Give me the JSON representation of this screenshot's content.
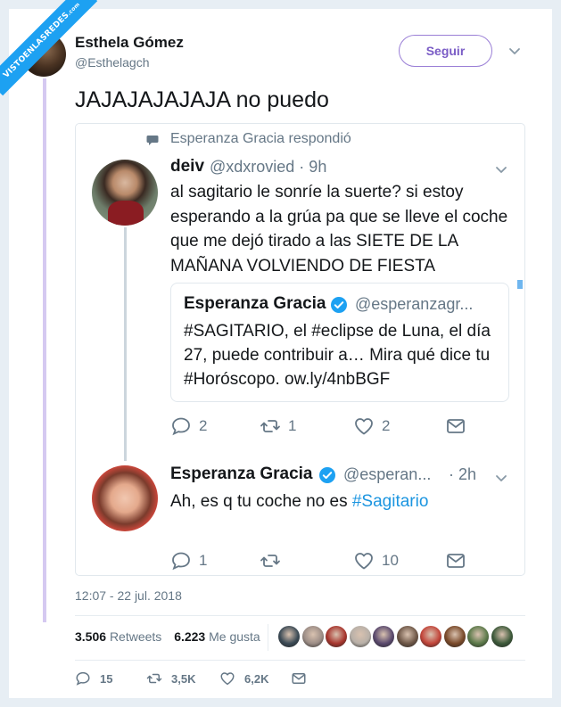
{
  "watermark": {
    "text": "VISTOENLASREDES",
    "suffix": ".com"
  },
  "author": {
    "name": "Esthela Gómez",
    "handle": "@Esthelagch"
  },
  "follow_label": "Seguir",
  "tweet_text": "JAJAJAJAJAJA no puedo",
  "reply_context": "Esperanza Gracia respondió",
  "reply_tweet": {
    "name": "deiv",
    "handle_time": "@xdxrovied · 9h",
    "text": "al sagitario le sonríe la suerte? si estoy esperando a la grúa pa que se lleve el coche que me dejó tirado a las SIETE DE LA MAÑANA VOLVIENDO DE FIESTA",
    "quote": {
      "name": "Esperanza Gracia",
      "handle": "@esperanzagr...",
      "text": "#SAGITARIO, el #eclipse de Luna, el día 27, puede contribuir a… Mira qué dice tu #Horóscopo. ow.ly/4nbBGF"
    },
    "actions": {
      "replies": "2",
      "retweets": "1",
      "likes": "2"
    }
  },
  "second_tweet": {
    "name": "Esperanza Gracia",
    "handle": "@esperan...",
    "time": "· 2h",
    "text_prefix": "Ah, es q tu coche no es ",
    "hashtag": "#Sagitario",
    "actions": {
      "replies": "1",
      "retweets": "",
      "likes": "10"
    }
  },
  "timestamp": "12:07 - 22 jul. 2018",
  "stats": {
    "retweets_count": "3.506",
    "retweets_label": "Retweets",
    "likes_count": "6.223",
    "likes_label": "Me gusta"
  },
  "likers_colors": [
    "#3b4a55",
    "#9c8d86",
    "#a8362e",
    "#b8b0a8",
    "#5b4a6e",
    "#6f5848",
    "#c2453a",
    "#7a4a2a",
    "#5c7a4a",
    "#3d5a3a"
  ],
  "bottom_actions": {
    "replies": "15",
    "retweets": "3,5K",
    "likes": "6,2K"
  },
  "colors": {
    "accent_purple": "#7a5cc6",
    "link_blue": "#1b95e0",
    "muted": "#657786",
    "verified": "#1da1f2"
  }
}
